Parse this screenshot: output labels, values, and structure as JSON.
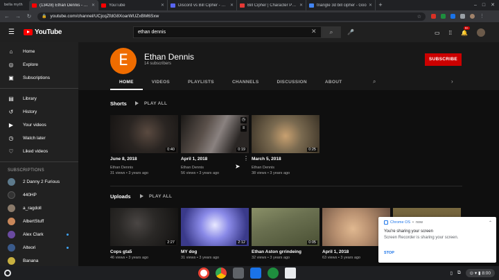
{
  "browser": {
    "profile_label": "bella myth",
    "tabs": [
      {
        "title": "(13428) Ethan Dennis - You",
        "favicon_color": "#ff0000",
        "active": true
      },
      {
        "title": "YouTube",
        "favicon_color": "#ff0000",
        "active": false
      },
      {
        "title": "Discord vs Bill Cipher - Batt",
        "favicon_color": "#202124",
        "active": false
      },
      {
        "title": "Bill Cipher | Character Profi",
        "favicon_color": "#e53935",
        "active": false
      },
      {
        "title": "triangle 3d bill cipher - Goo",
        "favicon_color": "#4285f4",
        "active": false
      }
    ],
    "url": "youtube.com/channel/UCjcqZfdG8XoarWUZxBM6Sxw"
  },
  "header": {
    "logo_text": "YouTube",
    "search_value": "ethan dennis",
    "notification_count": "9+"
  },
  "sidebar": {
    "items": [
      {
        "label": "Home",
        "icon": "⌂"
      },
      {
        "label": "Explore",
        "icon": "◎"
      },
      {
        "label": "Subscriptions",
        "icon": "▣"
      }
    ],
    "library_items": [
      {
        "label": "Library",
        "icon": "▤"
      },
      {
        "label": "History",
        "icon": "↺"
      },
      {
        "label": "Your videos",
        "icon": "▶"
      },
      {
        "label": "Watch later",
        "icon": "◷"
      },
      {
        "label": "Liked videos",
        "icon": "👍"
      }
    ],
    "subscriptions_heading": "SUBSCRIPTIONS",
    "subscriptions": [
      {
        "label": "2 Danny 2 Furious",
        "color": "#5d7a8c",
        "dot": false
      },
      {
        "label": "440HP",
        "color": "#333333",
        "dot": false
      },
      {
        "label": "a_ragdoll",
        "color": "#8a7a6a",
        "dot": false
      },
      {
        "label": "AlbertStuff",
        "color": "#c9875a",
        "dot": false
      },
      {
        "label": "Alex Clark",
        "color": "#6a4aa0",
        "dot": true
      },
      {
        "label": "Alteori",
        "color": "#3a5a8a",
        "dot": true
      },
      {
        "label": "Banana",
        "color": "#c8b040",
        "dot": false
      }
    ]
  },
  "channel": {
    "avatar_letter": "E",
    "name": "Ethan Dennis",
    "subscribers": "14 subscribers",
    "subscribe_label": "SUBSCRIBE",
    "tabs": [
      "HOME",
      "VIDEOS",
      "PLAYLISTS",
      "CHANNELS",
      "DISCUSSION",
      "ABOUT"
    ]
  },
  "shorts": {
    "title": "Shorts",
    "play_all": "PLAY ALL",
    "videos": [
      {
        "title": "June 8, 2018",
        "duration": "0:40",
        "channel": "Ethan Dennis",
        "meta": "31 views • 3 years ago",
        "color": "#2a2522"
      },
      {
        "title": "April 1, 2018",
        "duration": "0:19",
        "channel": "Ethan Dennis",
        "meta": "56 views • 3 years ago",
        "color": "#4a4240"
      },
      {
        "title": "March 5, 2018",
        "duration": "0:25",
        "channel": "Ethan Dennis",
        "meta": "38 views • 3 years ago",
        "color": "#7a6a50"
      }
    ]
  },
  "uploads": {
    "title": "Uploads",
    "play_all": "PLAY ALL",
    "videos": [
      {
        "title": "Cops gta5",
        "duration": "2:27",
        "meta": "46 views • 3 years ago",
        "color": "#2a2826"
      },
      {
        "title": "MY dog",
        "duration": "2:12",
        "meta": "31 views • 3 years ago",
        "color": "#7a7ad8"
      },
      {
        "title": "Ethan Aston grrindeing",
        "duration": "0:05",
        "meta": "32 views • 3 years ago",
        "color": "#6a7050"
      },
      {
        "title": "April 1, 2018",
        "duration": "",
        "meta": "63 views • 3 years ago",
        "color": "#b89070"
      },
      {
        "title": "",
        "duration": "",
        "meta": "",
        "color": "#5a4a30"
      }
    ]
  },
  "notification": {
    "app": "Chrome OS",
    "time": "now",
    "title": "You're sharing your screen",
    "body": "Screen Recorder is sharing your screen.",
    "action": "STOP"
  },
  "shelf": {
    "apps": [
      {
        "name": "gmail",
        "color": "#ea4335"
      },
      {
        "name": "chrome",
        "color": "#34a853"
      },
      {
        "name": "files-app",
        "color": "#5f6368"
      },
      {
        "name": "folder",
        "color": "#1a73e8"
      },
      {
        "name": "code",
        "color": "#1e8e3e"
      },
      {
        "name": "clapper",
        "color": "#e8eaed"
      }
    ],
    "time": "8:00"
  }
}
